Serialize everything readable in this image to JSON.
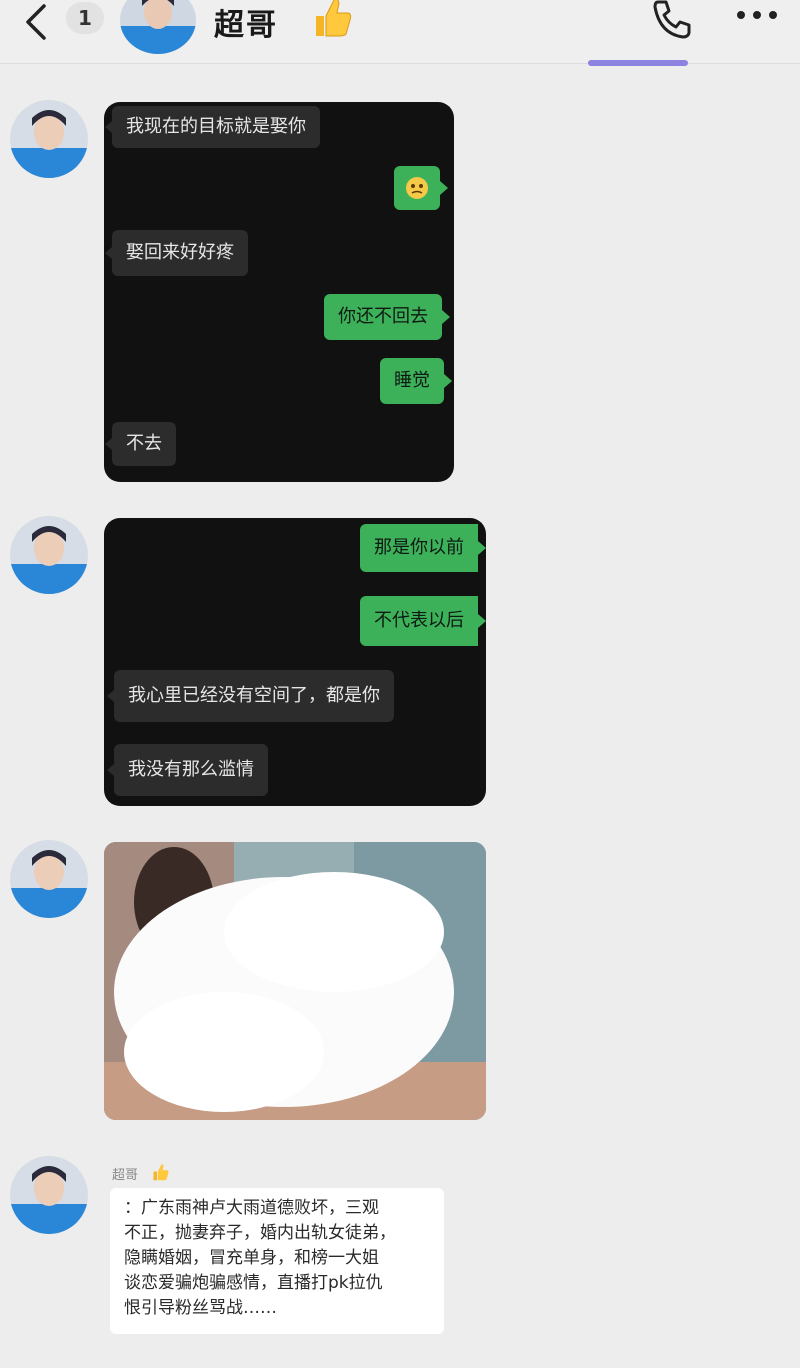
{
  "header": {
    "unread_count": "1",
    "contact_name": "超哥",
    "name_emoji": "thumbs-up-emoji",
    "call_icon": "phone-icon",
    "more_icon": "more-icon"
  },
  "screenshot1": {
    "messages": [
      {
        "side": "in",
        "text": "我现在的目标就是娶你"
      },
      {
        "side": "out",
        "text": "",
        "emoji": "face-emoji"
      },
      {
        "side": "in",
        "text": "娶回来好好疼"
      },
      {
        "side": "out",
        "text": "你还不回去"
      },
      {
        "side": "out",
        "text": "睡觉"
      },
      {
        "side": "in",
        "text": "不去"
      }
    ]
  },
  "screenshot2": {
    "messages": [
      {
        "side": "out",
        "text": "那是你以前"
      },
      {
        "side": "out",
        "text": "不代表以后"
      },
      {
        "side": "in",
        "text": "我心里已经没有空间了，都是你"
      },
      {
        "side": "in",
        "text": "我没有那么滥情"
      }
    ]
  },
  "photo": {
    "label": "blurred-photo"
  },
  "last_message": {
    "sender_name": "超哥",
    "sender_emoji": "thumbs-up-emoji",
    "lines": [
      "：广东雨神卢大雨道德败坏，三观",
      "不正，抛妻弃子，婚内出轨女徒弟，",
      "隐瞒婚姻，冒充单身，和榜一大姐",
      "谈恋爱骗炮骗感情，直播打pk拉仇",
      "恨引导粉丝骂战……"
    ]
  },
  "colors": {
    "bg": "#ededed",
    "bubble_out": "#3cb15a",
    "bubble_in_dark": "#2c2c2c",
    "screenshot_bg": "#111111"
  }
}
